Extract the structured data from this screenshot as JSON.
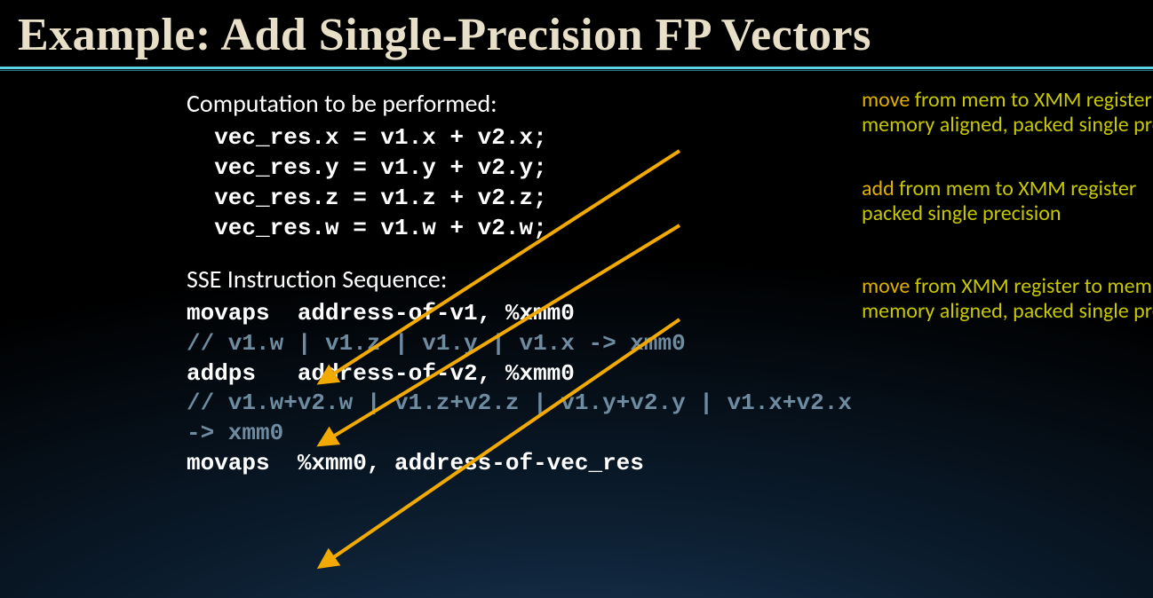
{
  "title": "Example:  Add Single-Precision FP Vectors",
  "section1": "Computation to be performed:",
  "code": {
    "c1": "  vec_res.x = v1.x + v2.x;",
    "c2": "  vec_res.y = v1.y + v2.y;",
    "c3": "  vec_res.z = v1.z + v2.z;",
    "c4": "  vec_res.w = v1.w + v2.w;"
  },
  "section2": "SSE Instruction Sequence:",
  "asm": {
    "l1": "movaps  address-of-v1, %xmm0",
    "l2": "// v1.w | v1.z | v1.y | v1.x -> xmm0",
    "l3": "addps   address-of-v2, %xmm0",
    "l4": "// v1.w+v2.w | v1.z+v2.z | v1.y+v2.y | v1.x+v2.x",
    "l5": "-> xmm0",
    "l6": "movaps  %xmm0, address-of-vec_res"
  },
  "annot": {
    "a1a": "move",
    "a1b": " from mem to XMM register",
    "a1c": "memory aligned, packed single precision",
    "a2a": "add",
    "a2b": " from mem to XMM register",
    "a2c": "packed single precision",
    "a3a": "move",
    "a3b": " from XMM register to mem",
    "a3c": "memory aligned, packed single precision"
  }
}
